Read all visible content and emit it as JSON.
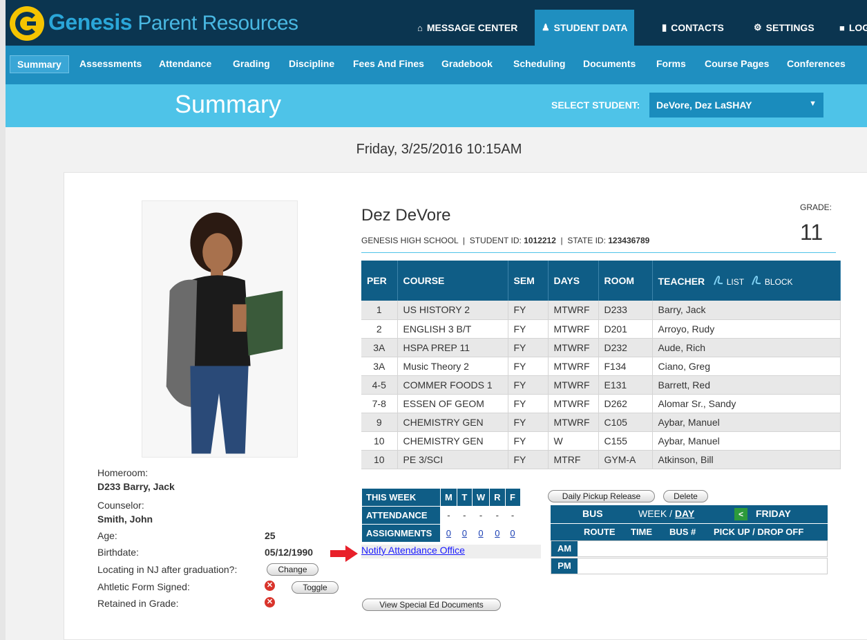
{
  "brand": {
    "name": "Genesis",
    "suffix": "Parent Resources"
  },
  "top_nav": [
    {
      "label": "MESSAGE CENTER",
      "icon": "home-icon"
    },
    {
      "label": "STUDENT DATA",
      "icon": "users-icon"
    },
    {
      "label": "CONTACTS",
      "icon": "book-icon"
    },
    {
      "label": "SETTINGS",
      "icon": "gear-icon"
    },
    {
      "label": "LOG",
      "icon": "lock-icon"
    }
  ],
  "menu": [
    "Summary",
    "Assessments",
    "Attendance",
    "Grading",
    "Discipline",
    "Fees And Fines",
    "Gradebook",
    "Scheduling",
    "Documents",
    "Forms",
    "Course Pages",
    "Conferences"
  ],
  "banner": {
    "title": "Summary",
    "select_label": "SELECT STUDENT:",
    "selected_student": "DeVore, Dez LaSHAY"
  },
  "datetime": "Friday, 3/25/2016 10:15AM",
  "student": {
    "first": "Dez",
    "last": "DeVore",
    "school": "GENESIS HIGH SCHOOL",
    "student_id_label": "STUDENT ID:",
    "student_id": "1012212",
    "state_id_label": "STATE ID:",
    "state_id": "123436789",
    "grade_label": "GRADE:",
    "grade": "11"
  },
  "details": {
    "homeroom_label": "Homeroom:",
    "homeroom": "D233  Barry, Jack",
    "counselor_label": "Counselor:",
    "counselor": "Smith, John",
    "age_label": "Age:",
    "age": "25",
    "birthdate_label": "Birthdate:",
    "birthdate": "05/12/1990",
    "locating_label": "Locating in NJ after graduation?:",
    "change_button": "Change",
    "athletic_label": "Ahtletic Form Signed:",
    "toggle_button": "Toggle",
    "retained_label": "Retained in Grade:",
    "special_ed_button": "View Special Ed Documents"
  },
  "schedule": {
    "headers": [
      "PER",
      "COURSE",
      "SEM",
      "DAYS",
      "ROOM",
      "TEACHER"
    ],
    "list_label": "LIST",
    "block_label": "BLOCK",
    "rows": [
      [
        "1",
        "US HISTORY 2",
        "FY",
        "MTWRF",
        "D233",
        "Barry, Jack"
      ],
      [
        "2",
        "ENGLISH 3 B/T",
        "FY",
        "MTWRF",
        "D201",
        "Arroyo, Rudy"
      ],
      [
        "3A",
        "HSPA PREP 11",
        "FY",
        "MTWRF",
        "D232",
        "Aude, Rich"
      ],
      [
        "3A",
        "Music Theory 2",
        "FY",
        "MTWRF",
        "F134",
        "Ciano, Greg"
      ],
      [
        "4-5",
        "COMMER FOODS 1",
        "FY",
        "MTWRF",
        "E131",
        "Barrett, Red"
      ],
      [
        "7-8",
        "ESSEN OF GEOM",
        "FY",
        "MTWRF",
        "D262",
        "Alomar Sr., Sandy"
      ],
      [
        "9",
        "CHEMISTRY GEN",
        "FY",
        "MTWRF",
        "C105",
        "Aybar, Manuel"
      ],
      [
        "10",
        "CHEMISTRY GEN",
        "FY",
        "W",
        "C155",
        "Aybar, Manuel"
      ],
      [
        "10",
        "PE 3/SCI",
        "FY",
        "MTRF",
        "GYM-A",
        "Atkinson, Bill"
      ]
    ]
  },
  "this_week": {
    "title": "THIS WEEK",
    "days": [
      "M",
      "T",
      "W",
      "R",
      "F"
    ],
    "attendance_label": "ATTENDANCE",
    "attendance": [
      "-",
      "-",
      "-",
      "-",
      "-"
    ],
    "assignments_label": "ASSIGNMENTS",
    "assignments": [
      "0",
      "0",
      "0",
      "0",
      "0"
    ],
    "notify_link": "Notify Attendance Office"
  },
  "pickup": {
    "release_button": "Daily Pickup Release",
    "delete_button": "Delete"
  },
  "bus": {
    "title": "BUS",
    "week_label": "WEEK",
    "day_label": "DAY",
    "friday_label": "FRIDAY",
    "prev_label": "<",
    "columns": [
      "ROUTE",
      "TIME",
      "BUS #",
      "PICK UP / DROP OFF"
    ],
    "rows": [
      "AM",
      "PM"
    ]
  },
  "colors": {
    "navy": "#0b3550",
    "blue": "#1f8fc0",
    "light_blue": "#4ec3e8",
    "table_header": "#0f5d86"
  }
}
